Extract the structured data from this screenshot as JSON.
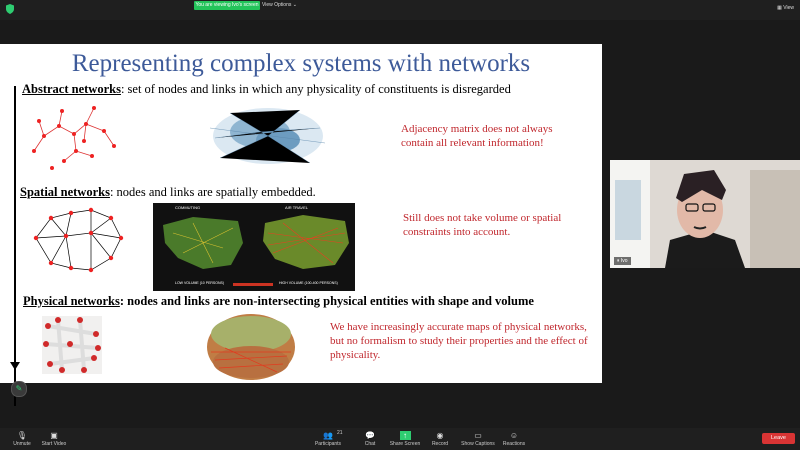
{
  "topbar": {
    "viewing_label": "You are viewing Ivo's screen",
    "view_options_label": "View Options",
    "view_label": "View"
  },
  "slide": {
    "title": "Representing complex systems with networks",
    "abstract_heading": "Abstract networks",
    "abstract_text": ": set of nodes and links in which any physicality of constituents is disregarded",
    "abstract_note": "Adjacency matrix does not always contain all relevant information!",
    "spatial_heading": "Spatial networks",
    "spatial_text": ": nodes and links are spatially embedded.",
    "spatial_note": "Still does not take volume or spatial constraints into account.",
    "map_left_label": "COMMUTING",
    "map_right_label": "AIR TRAVEL",
    "map_low_label": "LOW VOLUME (10 PERSONS)",
    "map_high_label": "HIGH VOLUME (100-400 PERSONS)",
    "physical_heading": "Physical networks",
    "physical_text": ": nodes and links are non-intersecting physical entities with shape and volume",
    "physical_note": "We have increasingly accurate maps of physical networks, but no formalism to study their properties and the effect of physicality."
  },
  "video": {
    "name": "Ivo"
  },
  "toolbar": {
    "unmute": "Unmute",
    "start_video": "Start Video",
    "participants": "Participants",
    "participants_count": "21",
    "chat": "Chat",
    "share_screen": "Share Screen",
    "record": "Record",
    "captions": "Show Captions",
    "reactions": "Reactions",
    "leave": "Leave"
  },
  "colors": {
    "title": "#3d5a99",
    "note": "#c0272d",
    "leave": "#d93434",
    "banner": "#23c45a"
  }
}
